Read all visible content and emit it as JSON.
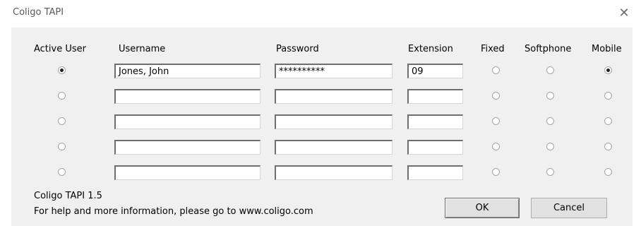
{
  "window": {
    "title": "Coligo TAPI",
    "close_glyph": "✕"
  },
  "headers": {
    "active_user": "Active User",
    "username": "Username",
    "password": "Password",
    "extension": "Extension",
    "fixed": "Fixed",
    "softphone": "Softphone",
    "mobile": "Mobile"
  },
  "rows": [
    {
      "active": true,
      "username": "Jones, John",
      "password": "**********",
      "extension": "09",
      "mode": "mobile"
    },
    {
      "active": false,
      "username": "",
      "password": "",
      "extension": "",
      "mode": ""
    },
    {
      "active": false,
      "username": "",
      "password": "",
      "extension": "",
      "mode": ""
    },
    {
      "active": false,
      "username": "",
      "password": "",
      "extension": "",
      "mode": ""
    },
    {
      "active": false,
      "username": "",
      "password": "",
      "extension": "",
      "mode": ""
    }
  ],
  "footer": {
    "version": "Coligo TAPI 1.5",
    "help": "For help and more information, please go to www.coligo.com"
  },
  "buttons": {
    "ok": "OK",
    "cancel": "Cancel"
  }
}
